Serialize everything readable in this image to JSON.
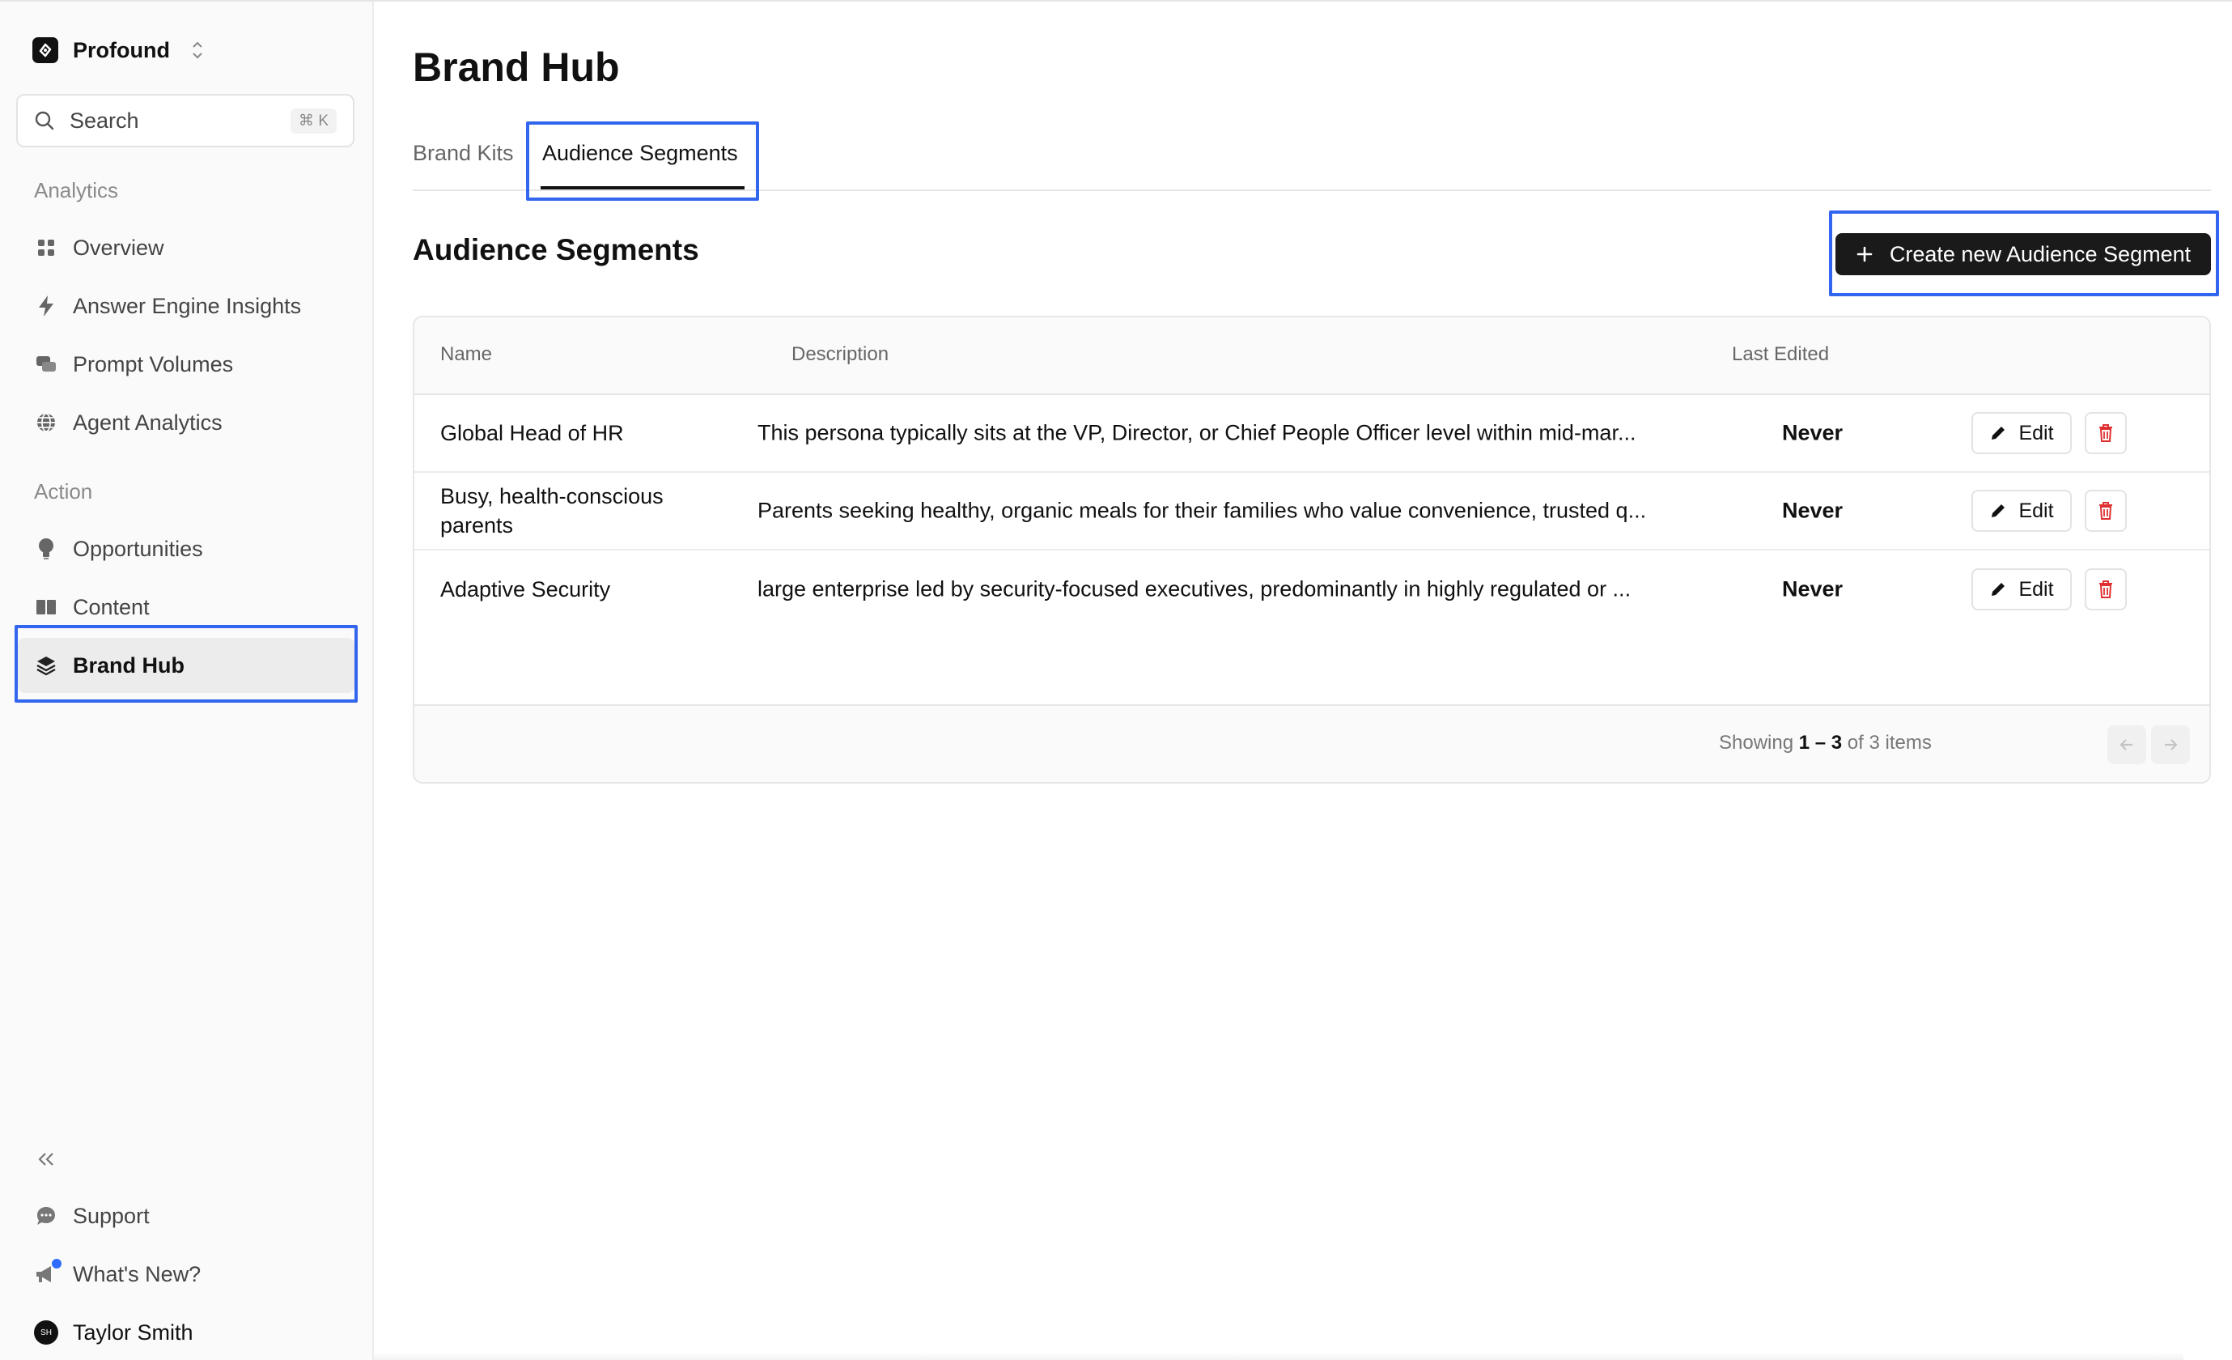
{
  "workspace": {
    "name": "Profound"
  },
  "search": {
    "label": "Search",
    "shortcut": "⌘ K"
  },
  "sidebar": {
    "analytics_label": "Analytics",
    "analytics_items": [
      {
        "label": "Overview",
        "icon": "grid-icon"
      },
      {
        "label": "Answer Engine Insights",
        "icon": "lightning-icon"
      },
      {
        "label": "Prompt Volumes",
        "icon": "chat-bubbles-icon"
      },
      {
        "label": "Agent Analytics",
        "icon": "globe-icon"
      }
    ],
    "action_label": "Action",
    "action_items": [
      {
        "label": "Opportunities",
        "icon": "lightbulb-icon"
      },
      {
        "label": "Content",
        "icon": "book-icon"
      },
      {
        "label": "Brand Hub",
        "icon": "layers-icon",
        "active": true
      }
    ],
    "bottom_items": [
      {
        "label": "Support",
        "icon": "chat-icon"
      },
      {
        "label": "What's New?",
        "icon": "megaphone-icon"
      },
      {
        "label": "Taylor Smith",
        "icon": "avatar",
        "initials": "SH"
      }
    ]
  },
  "page": {
    "title": "Brand Hub",
    "tabs": [
      {
        "label": "Brand Kits",
        "active": false
      },
      {
        "label": "Audience Segments",
        "active": true
      }
    ],
    "section_title": "Audience Segments",
    "create_button": "Create new Audience Segment"
  },
  "table": {
    "columns": [
      "Name",
      "Description",
      "Last Edited"
    ],
    "rows": [
      {
        "name": "Global Head of HR",
        "description": "This persona typically sits at the VP, Director, or Chief People Officer level within mid-mar...",
        "last_edited": "Never"
      },
      {
        "name": "Busy, health-conscious parents",
        "description": "Parents seeking healthy, organic meals for their families who value convenience, trusted q...",
        "last_edited": "Never"
      },
      {
        "name": "Adaptive Security",
        "description": "large enterprise led by security-focused executives, predominantly in highly regulated or ...",
        "last_edited": "Never"
      }
    ],
    "edit_label": "Edit",
    "pagination": {
      "prefix": "Showing",
      "range": "1 – 3",
      "of": "of",
      "total": "3",
      "suffix": "items"
    }
  },
  "colors": {
    "highlight": "#3366ee",
    "primary_button": "#1a1a1a",
    "delete": "#e03131",
    "notification_dot": "#2f6bff"
  }
}
